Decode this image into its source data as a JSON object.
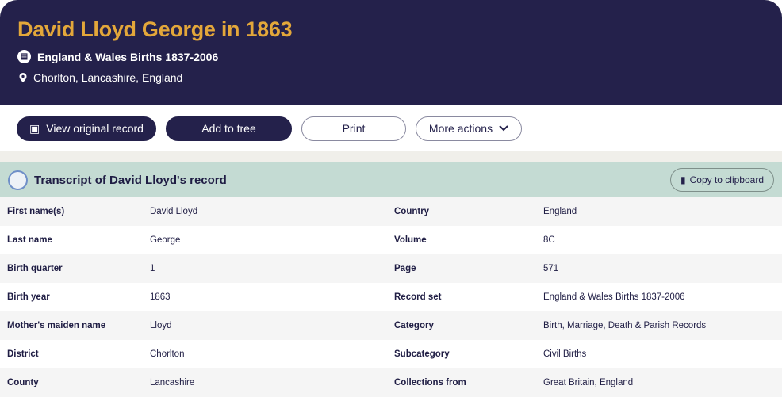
{
  "header": {
    "title": "David Lloyd George in 1863",
    "collection": "England & Wales Births 1837-2006",
    "location": "Chorlton, Lancashire, England"
  },
  "actions": {
    "view_original": "View original record",
    "add_to_tree": "Add to tree",
    "print": "Print",
    "more_actions": "More actions"
  },
  "transcript": {
    "title": "Transcript of David Lloyd's record",
    "copy": "Copy to clipboard",
    "rows": [
      {
        "l1": "First name(s)",
        "v1": "David Lloyd",
        "l2": "Country",
        "v2": "England"
      },
      {
        "l1": "Last name",
        "v1": "George",
        "l2": "Volume",
        "v2": "8C"
      },
      {
        "l1": "Birth quarter",
        "v1": "1",
        "l2": "Page",
        "v2": "571"
      },
      {
        "l1": "Birth year",
        "v1": "1863",
        "l2": "Record set",
        "v2": "England & Wales Births 1837-2006"
      },
      {
        "l1": "Mother's maiden name",
        "v1": "Lloyd",
        "l2": "Category",
        "v2": "Birth, Marriage, Death & Parish Records"
      },
      {
        "l1": "District",
        "v1": "Chorlton",
        "l2": "Subcategory",
        "v2": "Civil Births"
      },
      {
        "l1": "County",
        "v1": "Lancashire",
        "l2": "Collections from",
        "v2": "Great Britain, England"
      }
    ]
  }
}
